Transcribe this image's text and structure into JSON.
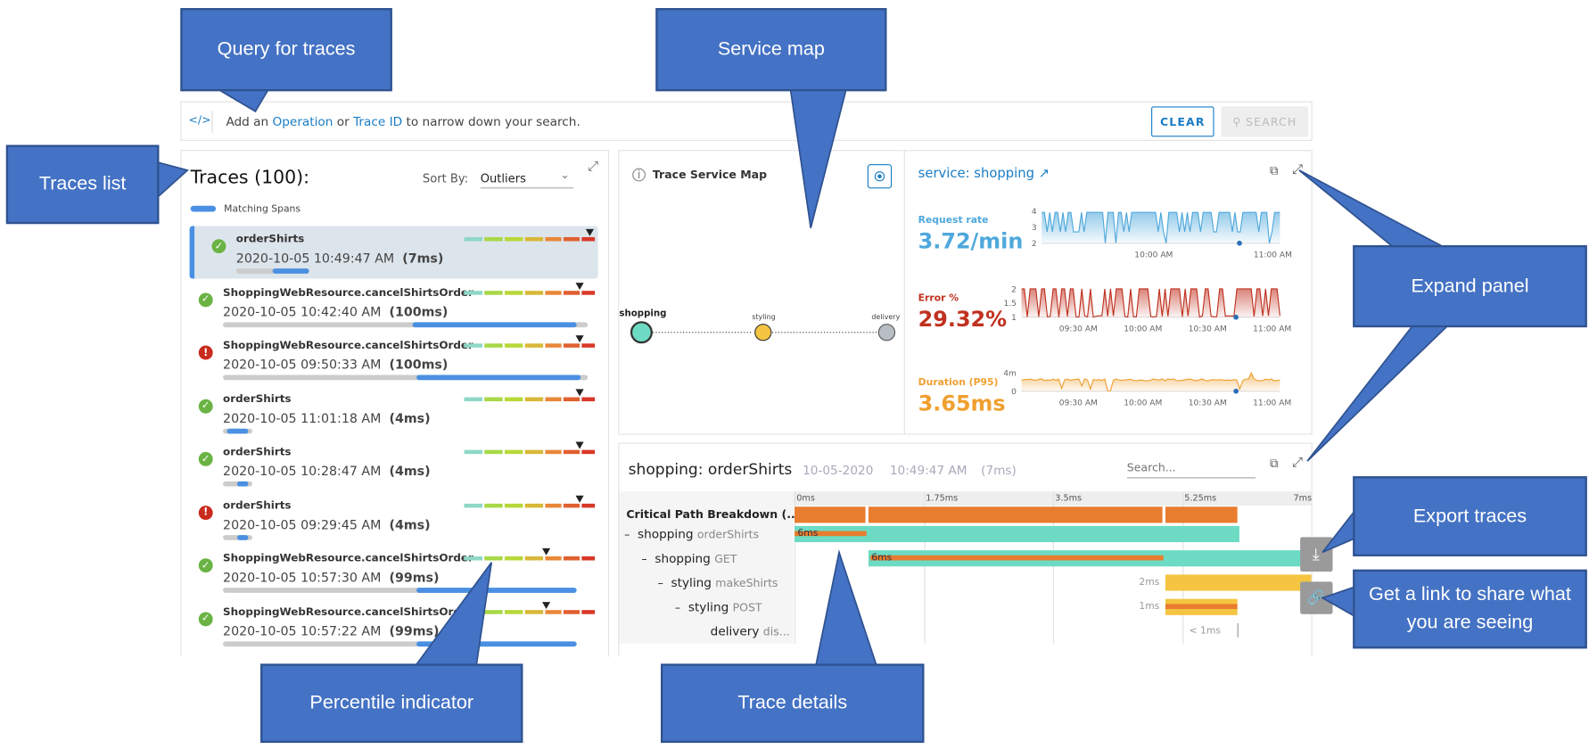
{
  "search": {
    "prefix": "Add an",
    "operation": "Operation",
    "or": "or",
    "trace_id": "Trace ID",
    "suffix": "to narrow down your search.",
    "clear": "CLEAR",
    "search": "SEARCH",
    "icon": "code-icon"
  },
  "traces": {
    "title": "Traces (100):",
    "sort_label": "Sort By:",
    "sort_value": "Outliers",
    "legend": "Matching Spans",
    "items": [
      {
        "name": "orderShirts",
        "date": "2020-10-05 10:49:47 AM",
        "duration": "(7ms)",
        "status": "ok",
        "selected": true,
        "percentile_marker": 0.99,
        "span_start": 0.1,
        "span_end": 0.2,
        "bar_len": 0.2
      },
      {
        "name": "ShoppingWebResource.cancelShirtsOrder",
        "date": "2020-10-05 10:42:40 AM",
        "duration": "(100ms)",
        "status": "ok",
        "percentile_marker": 0.91,
        "span_start": 0.52,
        "span_end": 0.97,
        "bar_len": 1
      },
      {
        "name": "ShoppingWebResource.cancelShirtsOrder",
        "date": "2020-10-05 09:50:33 AM",
        "duration": "(100ms)",
        "status": "error",
        "percentile_marker": 0.91,
        "span_start": 0.53,
        "span_end": 0.98,
        "bar_len": 1
      },
      {
        "name": "orderShirts",
        "date": "2020-10-05 11:01:18 AM",
        "duration": "(4ms)",
        "status": "ok",
        "percentile_marker": 0.91,
        "span_start": 0.01,
        "span_end": 0.07,
        "bar_len": 0.08
      },
      {
        "name": "orderShirts",
        "date": "2020-10-05 10:28:47 AM",
        "duration": "(4ms)",
        "status": "ok",
        "percentile_marker": 0.91,
        "span_start": 0.04,
        "span_end": 0.07,
        "bar_len": 0.08
      },
      {
        "name": "orderShirts",
        "date": "2020-10-05 09:29:45 AM",
        "duration": "(4ms)",
        "status": "error",
        "percentile_marker": 0.91,
        "span_start": 0.04,
        "span_end": 0.07,
        "bar_len": 0.08
      },
      {
        "name": "ShoppingWebResource.cancelShirtsOrder",
        "date": "2020-10-05 10:57:30 AM",
        "duration": "(99ms)",
        "status": "ok",
        "percentile_marker": 0.65,
        "span_start": 0.53,
        "span_end": 0.97,
        "bar_len": 0.97
      },
      {
        "name": "ShoppingWebResource.cancelShirtsOrder",
        "date": "2020-10-05 10:57:22 AM",
        "duration": "(99ms)",
        "status": "ok",
        "percentile_marker": 0.65,
        "span_start": 0.53,
        "span_end": 0.97,
        "bar_len": 0.97
      }
    ]
  },
  "service_map": {
    "title": "Trace Service Map",
    "nodes": [
      {
        "name": "shopping",
        "color": "#6ddbc4"
      },
      {
        "name": "styling",
        "color": "#f5c542"
      },
      {
        "name": "delivery",
        "color": "#b8bec4"
      }
    ]
  },
  "metrics": {
    "service": "service: shopping",
    "request": {
      "label": "Request rate",
      "value": "3.72/min",
      "color": "#4ea8dc",
      "yticks": [
        "4",
        "3",
        "2"
      ],
      "xticks": [
        "10:00 AM",
        "11:00 AM"
      ]
    },
    "error": {
      "label": "Error %",
      "value": "29.32%",
      "color": "#c0311f",
      "yticks": [
        "2",
        "1.5",
        "1"
      ],
      "xticks": [
        "09:30 AM",
        "10:00 AM",
        "10:30 AM",
        "11:00 AM"
      ]
    },
    "duration": {
      "label": "Duration (P95)",
      "value": "3.65ms",
      "color": "#f0a030",
      "yticks": [
        "4m",
        "0"
      ],
      "xticks": [
        "09:30 AM",
        "10:00 AM",
        "10:30 AM",
        "11:00 AM"
      ]
    }
  },
  "details": {
    "title": "shopping: orderShirts",
    "date": "10-05-2020",
    "time": "10:49:47 AM",
    "duration": "(7ms)",
    "search_placeholder": "Search...",
    "ticks": [
      "0ms",
      "1.75ms",
      "3.5ms",
      "5.25ms",
      "7ms"
    ],
    "critical": "Critical Path Breakdown (...",
    "rows": [
      {
        "service": "shopping",
        "op": "orderShirts",
        "label": "6ms"
      },
      {
        "service": "shopping",
        "op": "GET",
        "label": "6ms"
      },
      {
        "service": "styling",
        "op": "makeShirts",
        "label": "2ms"
      },
      {
        "service": "styling",
        "op": "POST",
        "label": "1ms"
      },
      {
        "service": "delivery",
        "op": "dis...",
        "label": "< 1ms"
      }
    ]
  },
  "callouts": {
    "query": "Query for traces",
    "service_map": "Service map",
    "traces_list": "Traces list",
    "expand": "Expand panel",
    "export": "Export traces",
    "link": "Get a link to share what you are seeing",
    "percentile": "Percentile indicator",
    "details": "Trace details"
  },
  "colors": {
    "callout": "#4472c4",
    "accent": "#1a7dc4",
    "ok": "#6ab344",
    "error": "#c92b1e",
    "teal": "#6ddbc4",
    "orange": "#e87d2f",
    "yellow": "#f5c542"
  }
}
